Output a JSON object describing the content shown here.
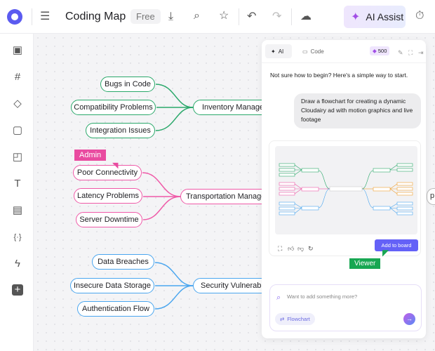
{
  "topbar": {
    "title": "Coding Map",
    "plan_badge": "Free",
    "ai_assist_label": "AI Assist",
    "icons": [
      "menu-icon",
      "download-icon",
      "search-icon",
      "star-icon",
      "undo-icon",
      "redo-icon",
      "cloud-sync-icon",
      "timer-icon"
    ]
  },
  "sidebar": {
    "items": [
      "layout-icon",
      "grid-icon",
      "shapes-icon",
      "components-icon",
      "sticky-note-icon",
      "text-icon",
      "image-icon",
      "code-icon",
      "lightning-icon",
      "add-icon"
    ]
  },
  "mindmap": {
    "green": {
      "parent": "Inventory Management",
      "children": [
        "Bugs in Code",
        "Compatibility Problems",
        "Integration Issues"
      ],
      "color": "#2aa86a"
    },
    "pink": {
      "parent": "Transportation Management",
      "children": [
        "Poor Connectivity",
        "Latency Problems",
        "Server Downtime"
      ],
      "color": "#ef5aa8"
    },
    "blue": {
      "parent": "Security Vulnerabilities",
      "children": [
        "Data Breaches",
        "Insecure Data Storage",
        "Authentication Flow"
      ],
      "color": "#4aa6ef"
    }
  },
  "cursors": {
    "admin": "Admin",
    "viewer": "Viewer"
  },
  "panel": {
    "tab_ai": "AI",
    "tab_code": "Code",
    "credits": "500",
    "intro": "Not sure how to begin? Here's a simple way to start.",
    "prompt": "Draw a flowchart for creating a dynamic Cloudairy ad with motion graphics and live footage",
    "add_to_board": "Add to board",
    "input_placeholder": "Want to add something more?",
    "mode_chip": "Flowchart"
  },
  "colors": {
    "accent": "#6461f7",
    "admin": "#e94ba0",
    "viewer": "#17a752"
  }
}
